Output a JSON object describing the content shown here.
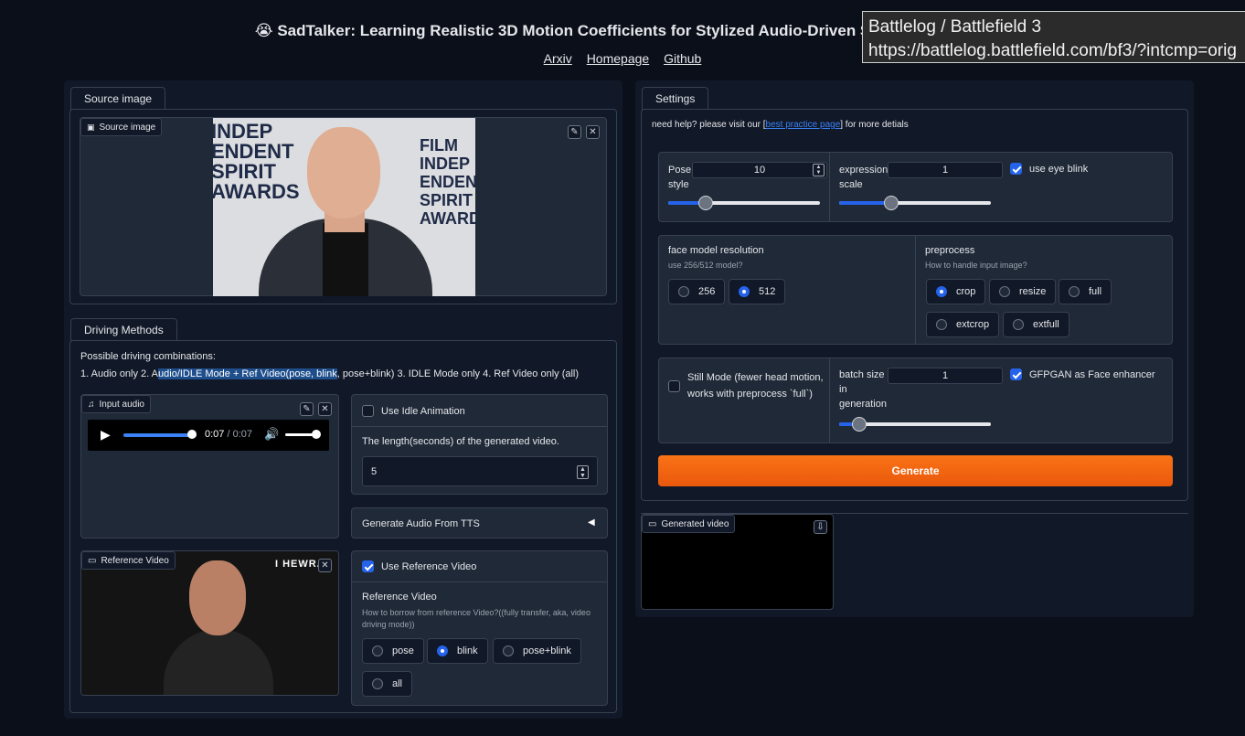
{
  "header": {
    "emoji": "😭",
    "title": "SadTalker: Learning Realistic 3D Motion Coefficients for Stylized Audio-Driven Single Image Talk",
    "links": [
      "Arxiv",
      "Homepage",
      "Github"
    ]
  },
  "tooltip": {
    "line1": "Battlelog / Battlefield 3",
    "line2": "https://battlelog.battlefield.com/bf3/?intcmp=orig"
  },
  "source": {
    "tab": "Source image",
    "label": "Source image",
    "photo_text": [
      "FILM",
      "INDEP",
      "ENDENT",
      "SPIRIT",
      "AWARDS"
    ]
  },
  "driving": {
    "tab": "Driving Methods",
    "combos_title": "Possible driving combinations:",
    "combos_pre": "1. Audio only 2. A",
    "combos_sel": "udio/IDLE Mode + Ref Video(pose, blink",
    "combos_post": ", pose+blink) 3. IDLE Mode only 4. Ref Video only (all)",
    "input_audio_label": "Input audio",
    "audio_time": "0:07",
    "audio_total": "0:07",
    "audio_sep": "/",
    "use_idle_label": "Use Idle Animation",
    "length_label": "The length(seconds) of the generated video.",
    "length_value": "5",
    "tts_label": "Generate Audio From TTS",
    "ref_video_label": "Reference Video",
    "ref_video_watermark": "I HEWRA",
    "use_ref_label": "Use Reference Video",
    "ref_title": "Reference Video",
    "ref_desc": "How to borrow from reference Video?((fully transfer, aka, video driving mode))",
    "ref_options": [
      "pose",
      "blink",
      "pose+blink",
      "all"
    ],
    "ref_selected": "blink"
  },
  "settings": {
    "tab": "Settings",
    "help_pre": "need help? please visit our [",
    "help_link": "best practice page",
    "help_post": "] for more detials",
    "pose_label_1": "Pose",
    "pose_label_2": "style",
    "pose_value": "10",
    "expr_label_1": "expression",
    "expr_label_2": "scale",
    "expr_value": "1",
    "eye_blink_label": "use eye blink",
    "face_res_title": "face model resolution",
    "face_res_desc": "use 256/512 model?",
    "face_res_options": [
      "256",
      "512"
    ],
    "face_res_selected": "512",
    "preprocess_title": "preprocess",
    "preprocess_desc": "How to handle input image?",
    "preprocess_options": [
      "crop",
      "resize",
      "full",
      "extcrop",
      "extfull"
    ],
    "preprocess_selected": "crop",
    "still_mode_label": "Still Mode (fewer head motion, works with preprocess `full`)",
    "batch_label_1": "batch size",
    "batch_label_2": "in",
    "batch_label_3": "generation",
    "batch_value": "1",
    "gfpgan_label": "GFPGAN as Face enhancer",
    "generate_label": "Generate",
    "generated_video_label": "Generated video"
  },
  "colors": {
    "background": "#0b0f19",
    "panel": "#111827",
    "block": "#1f2937",
    "accent": "#2563eb",
    "generate_orange": "#f97316"
  }
}
